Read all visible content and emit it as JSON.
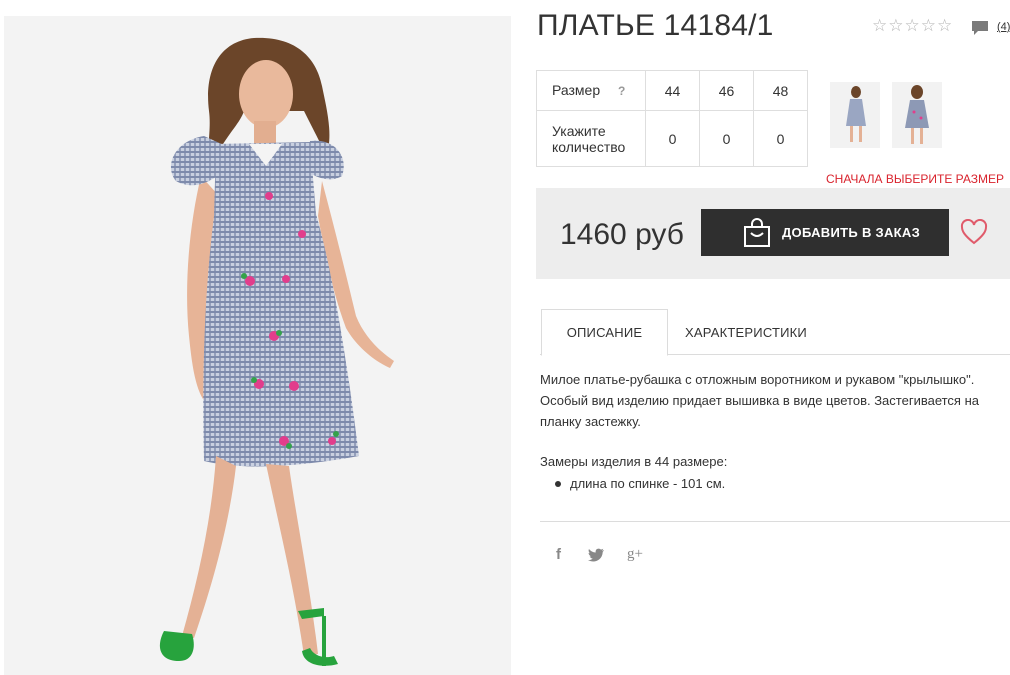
{
  "product": {
    "title": "ПЛАТЬЕ 14184/1",
    "rating_icons": [
      "star-outline-icon",
      "star-outline-icon",
      "star-outline-icon",
      "star-outline-icon",
      "star-outline-icon"
    ],
    "review_count": "(4)"
  },
  "size_table": {
    "size_label": "Размер",
    "size_hint": "?",
    "qty_label": "Укажите количество",
    "sizes": [
      "44",
      "46",
      "48"
    ],
    "quantities": [
      "0",
      "0",
      "0"
    ]
  },
  "size_warning": "СНАЧАЛА ВЫБЕРИТЕ РАЗМЕР",
  "purchase": {
    "price": "1460 руб",
    "add_button": "ДОБАВИТЬ В ЗАКАЗ"
  },
  "tabs": [
    {
      "label": "ОПИСАНИЕ",
      "active": true
    },
    {
      "label": "ХАРАКТЕРИСТИКИ",
      "active": false
    }
  ],
  "description": {
    "text": "Милое платье-рубашка с отложным воротником и рукавом \"крылышко\". Особый вид изделию придает вышивка в виде цветов. Застегивается на планку застежку.",
    "measurements_title": "Замеры изделия в 44 размере:",
    "measurements": [
      "длина по спинке - 101 см."
    ]
  },
  "social": {
    "facebook": "f",
    "google_plus": "g+"
  },
  "colors": {
    "warning": "#d9232d",
    "button_bg": "#2f2f2f",
    "price_bar_bg": "#ededed",
    "heart": "#e05b6b",
    "dress": "#8d99b5"
  }
}
